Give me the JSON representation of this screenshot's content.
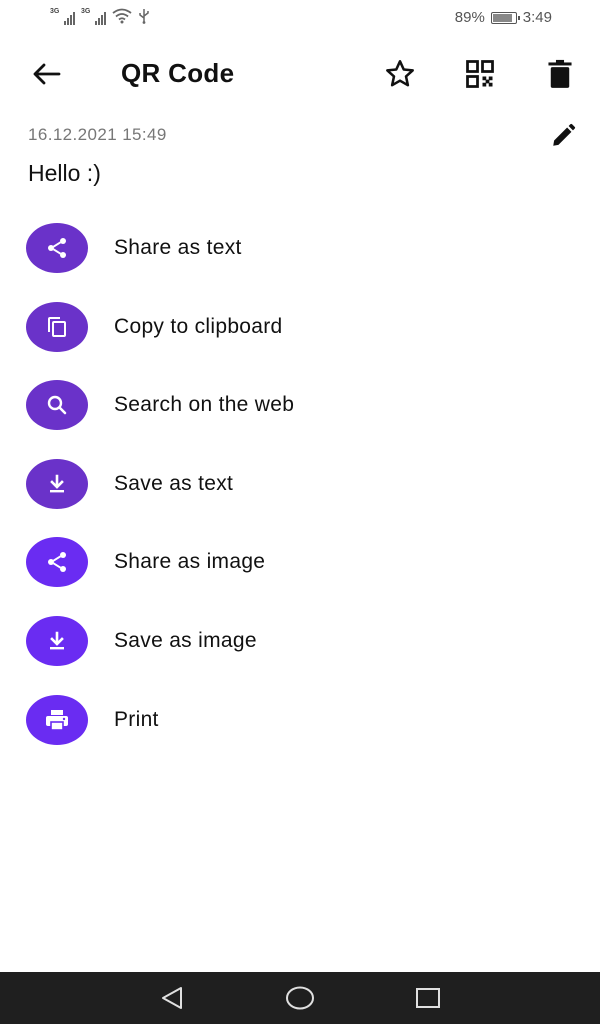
{
  "status_bar": {
    "network_1": "3G",
    "network_2": "3G",
    "battery_percent": "89%",
    "battery_level": 0.89,
    "time": "3:49"
  },
  "app_bar": {
    "title": "QR Code",
    "icons": {
      "back": "arrow-back-icon",
      "favorite": "star-outline-icon",
      "qr": "qr-code-icon",
      "delete": "trash-icon"
    }
  },
  "barcode": {
    "timestamp": "16.12.2021 15:49",
    "text": "Hello :)",
    "edit_icon": "pencil-icon"
  },
  "actions": [
    {
      "label": "Share as text",
      "icon": "share-icon",
      "color": "#6A32C9"
    },
    {
      "label": "Copy to clipboard",
      "icon": "copy-icon",
      "color": "#6A32C9"
    },
    {
      "label": "Search on the web",
      "icon": "search-icon",
      "color": "#6A32C9"
    },
    {
      "label": "Save as text",
      "icon": "download-icon",
      "color": "#6A32C9"
    },
    {
      "label": "Share as image",
      "icon": "share-icon",
      "color": "#6A2CF2"
    },
    {
      "label": "Save as image",
      "icon": "download-icon",
      "color": "#6A2CF2"
    },
    {
      "label": "Print",
      "icon": "printer-icon",
      "color": "#6A2CF2"
    }
  ],
  "nav_bar": {
    "background": "#1f1f1f",
    "icons": {
      "back": "triangle-back-icon",
      "home": "circle-home-icon",
      "recents": "square-recents-icon"
    }
  }
}
